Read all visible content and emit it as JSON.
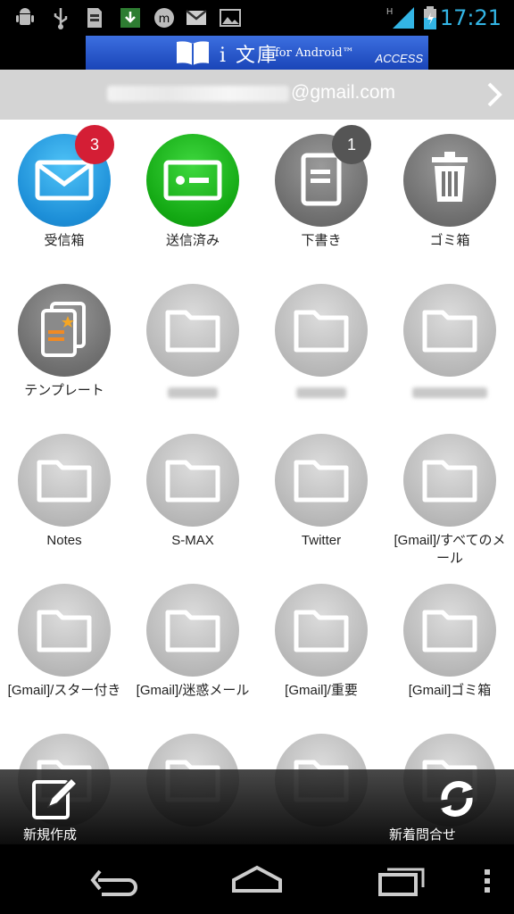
{
  "status_bar": {
    "icons_left": [
      "android-debug-icon",
      "usb-icon",
      "sd-card-icon",
      "download-icon",
      "messenger-icon",
      "gmail-icon",
      "image-icon"
    ],
    "signal": "H",
    "time": "17:21"
  },
  "ad": {
    "title": "i 文庫",
    "subtitle": "for Android™",
    "brand": "ACCESS"
  },
  "account": {
    "email_suffix": "@gmail.com"
  },
  "folders": [
    {
      "label": "受信箱",
      "badge": "3"
    },
    {
      "label": "送信済み"
    },
    {
      "label": "下書き",
      "badge": "1"
    },
    {
      "label": "ゴミ箱"
    },
    {
      "label": "テンプレート"
    },
    {
      "label": ""
    },
    {
      "label": ""
    },
    {
      "label": ""
    },
    {
      "label": "Notes"
    },
    {
      "label": "S-MAX"
    },
    {
      "label": "Twitter"
    },
    {
      "label": "[Gmail]/すべてのメール"
    },
    {
      "label": "[Gmail]/スター付き"
    },
    {
      "label": "[Gmail]/迷惑メール"
    },
    {
      "label": "[Gmail]/重要"
    },
    {
      "label": "[Gmail]ゴミ箱"
    }
  ],
  "actions": {
    "compose": "新規作成",
    "check": "新着問合せ"
  },
  "colors": {
    "accent_time": "#33b5e5",
    "inbox": "#1d8fd8",
    "sent": "#13a813",
    "badge_red": "#d41e35"
  }
}
